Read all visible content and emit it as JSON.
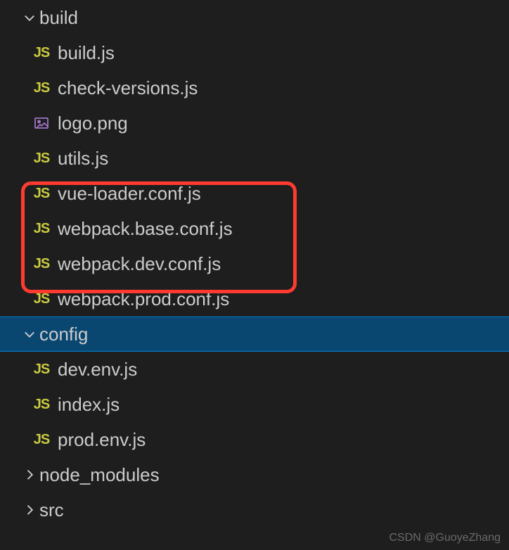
{
  "tree": {
    "folders": [
      {
        "name": "build",
        "expanded": true,
        "selected": false,
        "files": [
          {
            "name": "build.js",
            "type": "js"
          },
          {
            "name": "check-versions.js",
            "type": "js"
          },
          {
            "name": "logo.png",
            "type": "png"
          },
          {
            "name": "utils.js",
            "type": "js"
          },
          {
            "name": "vue-loader.conf.js",
            "type": "js"
          },
          {
            "name": "webpack.base.conf.js",
            "type": "js"
          },
          {
            "name": "webpack.dev.conf.js",
            "type": "js"
          },
          {
            "name": "webpack.prod.conf.js",
            "type": "js"
          }
        ]
      },
      {
        "name": "config",
        "expanded": true,
        "selected": true,
        "files": [
          {
            "name": "dev.env.js",
            "type": "js"
          },
          {
            "name": "index.js",
            "type": "js"
          },
          {
            "name": "prod.env.js",
            "type": "js"
          }
        ]
      },
      {
        "name": "node_modules",
        "expanded": false,
        "selected": false,
        "files": []
      },
      {
        "name": "src",
        "expanded": false,
        "selected": false,
        "files": []
      }
    ]
  },
  "watermark": "CSDN @GuoyeZhang",
  "icons": {
    "js_label": "JS"
  }
}
